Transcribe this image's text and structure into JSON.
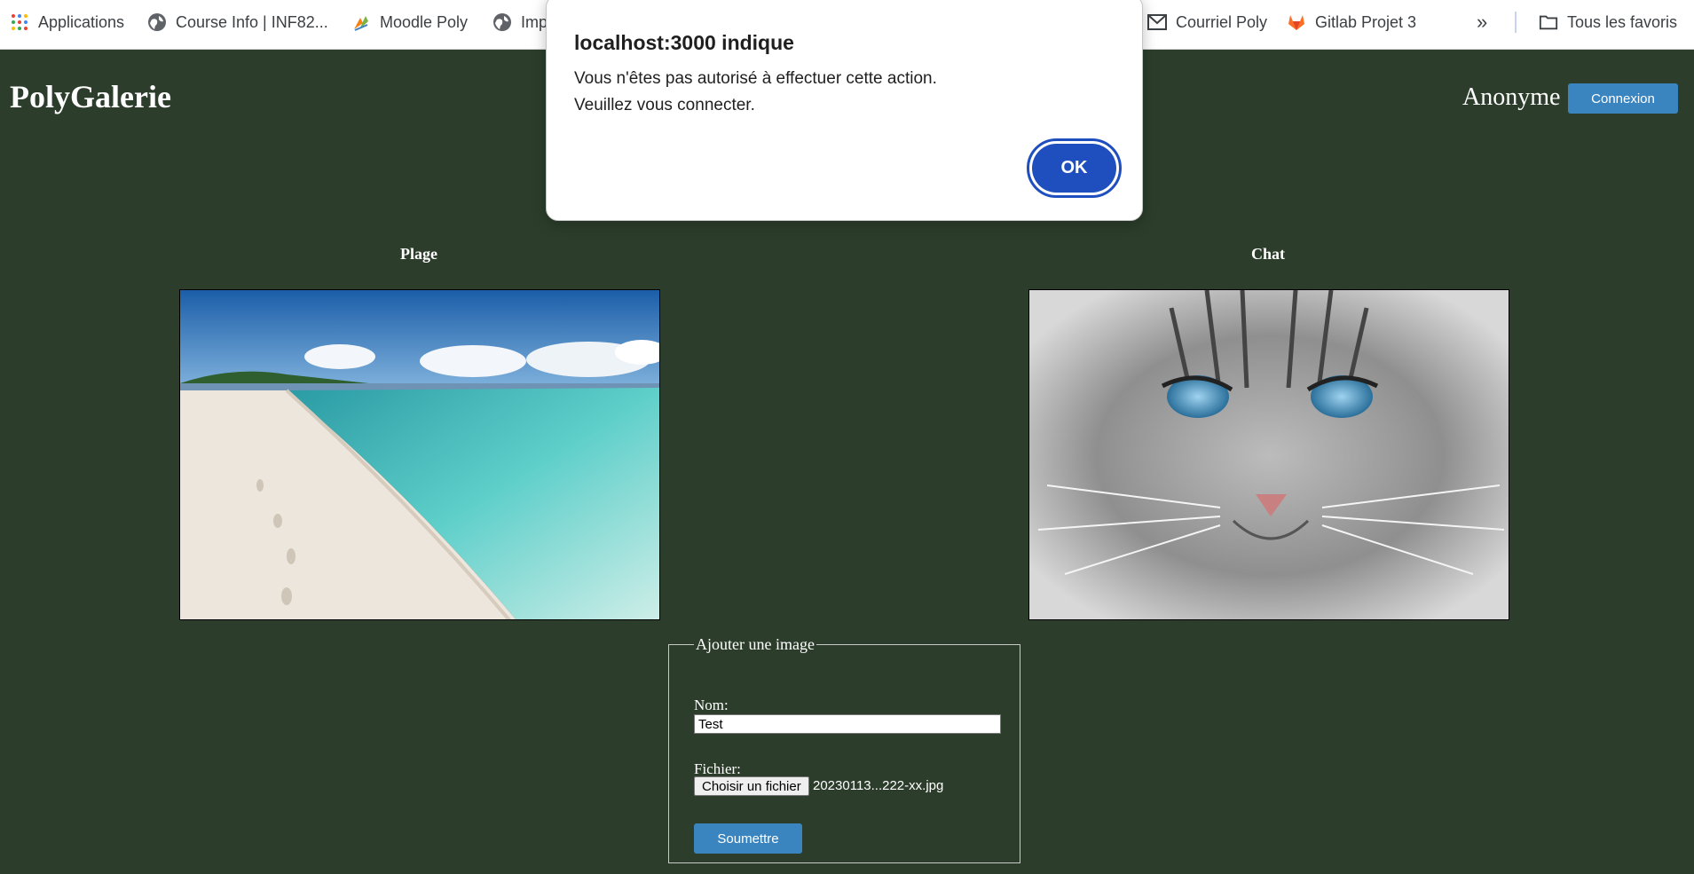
{
  "bookmarks": [
    {
      "label": "Applications",
      "icon": "apps-grid-icon"
    },
    {
      "label": "Course Info | INF82...",
      "icon": "globe-icon"
    },
    {
      "label": "Moodle Poly",
      "icon": "moodle-icon"
    },
    {
      "label": "Imp",
      "icon": "globe-icon"
    },
    {
      "label": "Courriel Poly",
      "icon": "mail-icon"
    },
    {
      "label": "Gitlab Projet 3",
      "icon": "gitlab-icon"
    },
    {
      "label": "»",
      "icon": "more-icon"
    },
    {
      "label": "Tous les favoris",
      "icon": "folder-icon"
    }
  ],
  "header": {
    "title": "PolyGalerie",
    "user": "Anonyme",
    "login_label": "Connexion"
  },
  "gallery": [
    {
      "caption": "Plage"
    },
    {
      "caption": "Chat"
    }
  ],
  "form": {
    "legend": "Ajouter une image",
    "name_label": "Nom:",
    "name_value": "Test",
    "file_label": "Fichier:",
    "file_button": "Choisir un fichier",
    "file_name": "20230113...222-xx.jpg",
    "submit_label": "Soumettre"
  },
  "dialog": {
    "title": "localhost:3000 indique",
    "line1": "Vous n'êtes pas autorisé à effectuer cette action.",
    "line2": "Veuillez vous connecter.",
    "ok_label": "OK"
  },
  "colors": {
    "background": "#2c3e2b",
    "button": "#3a85c0",
    "dialog_button": "#1f4fbf"
  }
}
